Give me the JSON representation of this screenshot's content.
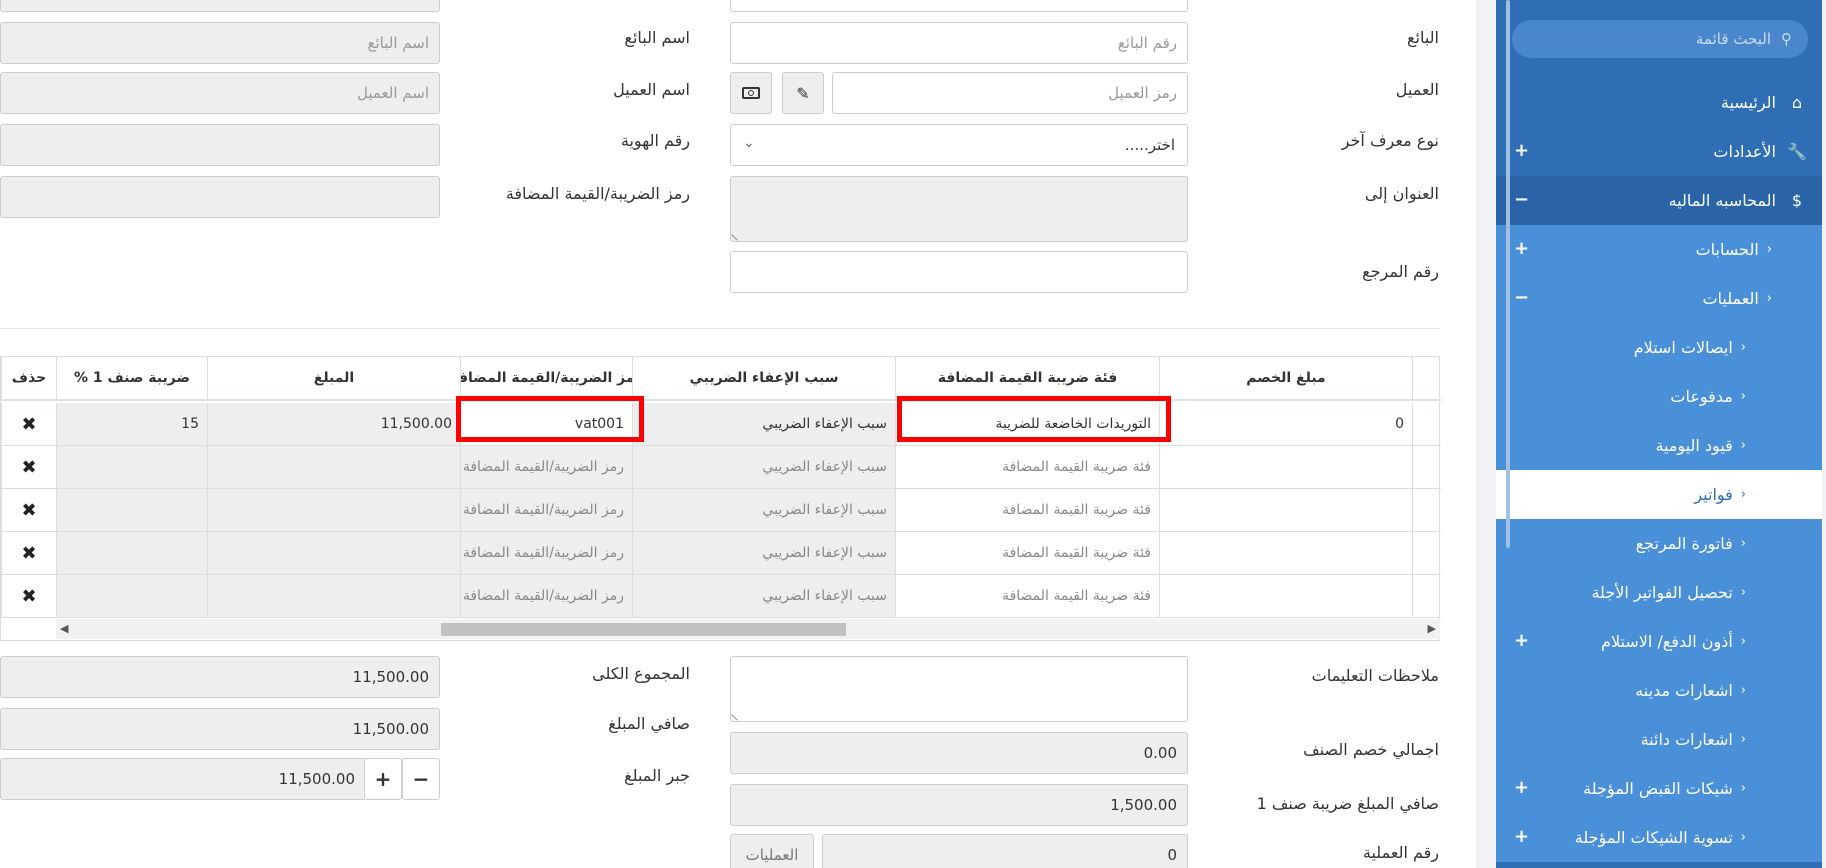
{
  "form": {
    "seller_label": "البائع",
    "seller_no_placeholder": "رقم البائع",
    "seller_name_label": "اسم البائع",
    "seller_name_placeholder": "اسم البائع",
    "customer_label": "العميل",
    "customer_code_placeholder": "رمز العميل",
    "customer_name_label": "اسم العميل",
    "customer_name_placeholder": "اسم العميل",
    "other_id_label": "نوع معرف آخر",
    "other_id_select": "اختر.....",
    "id_no_label": "رقم الهوية",
    "address_label": "العنوان إلى",
    "vat_code_label": "رمز الضريبة/القيمة المضافة",
    "ref_label": "رقم المرجع"
  },
  "grid": {
    "headers": {
      "discount": "مبلغ الخصم",
      "vat_category": "فئة ضريبة القيمة المضافة",
      "exemption": "سبب الإعفاء الضريبي",
      "vat_code": "رمز الضريبة/القيمة المضافة",
      "amount": "المبلغ",
      "tax1": "ضريبة صنف 1 %",
      "delete": "حذف"
    },
    "rows": [
      {
        "discount": "0",
        "vat_category": "التوريدات الخاضعة للضريبة",
        "exemption": "سبب الإعفاء الضريبي",
        "vat_code": "vat001",
        "amount": "11,500.00",
        "tax1": "15"
      },
      {
        "discount": "",
        "vat_category": "فئة ضريبة القيمة المضافة",
        "exemption": "سبب الإعفاء الضريبي",
        "vat_code": "رمز الضريبة/القيمة المضافة",
        "amount": "",
        "tax1": ""
      },
      {
        "discount": "",
        "vat_category": "فئة ضريبة القيمة المضافة",
        "exemption": "سبب الإعفاء الضريبي",
        "vat_code": "رمز الضريبة/القيمة المضافة",
        "amount": "",
        "tax1": ""
      },
      {
        "discount": "",
        "vat_category": "فئة ضريبة القيمة المضافة",
        "exemption": "سبب الإعفاء الضريبي",
        "vat_code": "رمز الضريبة/القيمة المضافة",
        "amount": "",
        "tax1": ""
      },
      {
        "discount": "",
        "vat_category": "فئة ضريبة القيمة المضافة",
        "exemption": "سبب الإعفاء الضريبي",
        "vat_code": "رمز الضريبة/القيمة المضافة",
        "amount": "",
        "tax1": ""
      }
    ],
    "delete_glyph": "✖"
  },
  "summary": {
    "notes_label": "ملاحظات التعليمات",
    "item_discount_label": "اجمالي خصم الصنف",
    "item_discount_value": "0.00",
    "net_tax_label": "صافي المبلغ ضريبة صنف 1",
    "net_tax_value": "1,500.00",
    "op_no_label": "رقم العملية",
    "op_no_value": "0",
    "ops_button": "العمليات",
    "total_label": "المجموع الكلى",
    "total_value": "11,500.00",
    "net_label": "صافي المبلغ",
    "net_value": "11,500.00",
    "round_label": "جبر المبلغ",
    "round_value": "11,500.00"
  },
  "sidebar": {
    "search_placeholder": "البحث قائمة",
    "items": [
      {
        "label": "الرئيسية"
      },
      {
        "label": "الأعدادات"
      },
      {
        "label": "المحاسبه الماليه"
      },
      {
        "label": "الحسابات"
      },
      {
        "label": "العمليات"
      },
      {
        "label": "ايصالات استلام"
      },
      {
        "label": "مدفوعات"
      },
      {
        "label": "قيود اليومية"
      },
      {
        "label": "فواتير"
      },
      {
        "label": "فاتورة المرتجع"
      },
      {
        "label": "تحصيل الفواتير الأجلة"
      },
      {
        "label": "أذون الدفع/ الاستلام"
      },
      {
        "label": "اشعارات مدينه"
      },
      {
        "label": "اشعارات دائنة"
      },
      {
        "label": "شيكات القبض المؤجلة"
      },
      {
        "label": "تسوية الشيكات المؤجلة"
      }
    ]
  },
  "colors": {
    "sidebar": "#2f6eb5",
    "sidebar_sub": "#4a90d9",
    "highlight": "#ff0000"
  }
}
